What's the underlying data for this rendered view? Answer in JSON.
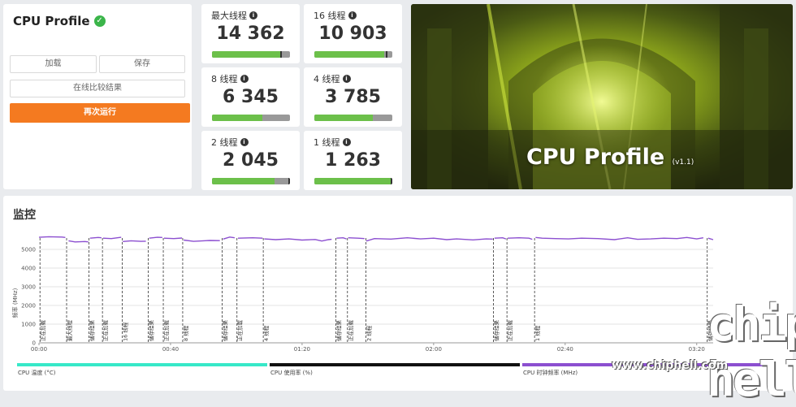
{
  "profile": {
    "title": "CPU Profile",
    "btn_load": "加载",
    "btn_save": "保存",
    "btn_compare": "在线比较结果",
    "btn_run": "再次运行"
  },
  "scores": [
    {
      "label": "最大线程",
      "value": "14 362",
      "fill": 0.9,
      "mark": 0.88
    },
    {
      "label": "16 线程",
      "value": "10 903",
      "fill": 0.9,
      "mark": 0.92
    },
    {
      "label": "8 线程",
      "value": "6 345",
      "fill": 0.65,
      "mark": null
    },
    {
      "label": "4 线程",
      "value": "3 785",
      "fill": 0.75,
      "mark": null
    },
    {
      "label": "2 线程",
      "value": "2 045",
      "fill": 0.8,
      "mark": 0.98
    },
    {
      "label": "1 线程",
      "value": "1 263",
      "fill": 0.98,
      "mark": 0.98
    }
  ],
  "banner": {
    "title": "CPU Profile",
    "version": "(v1.1)"
  },
  "monitor": {
    "title": "监控",
    "legend": [
      {
        "label": "CPU 温度 (°C)",
        "color": "#37e8c8"
      },
      {
        "label": "CPU 使用率 (%)",
        "color": "#111111"
      },
      {
        "label": "CPU 时钟频率 (MHz)",
        "color": "#8c4fd0"
      }
    ]
  },
  "chart_data": {
    "type": "line",
    "ylabel": "频率 (MHz)",
    "ylim": [
      0,
      6000
    ],
    "yticks": [
      0,
      1000,
      2000,
      3000,
      4000,
      5000
    ],
    "xticks": [
      "00:00",
      "00:40",
      "01:20",
      "02:00",
      "02:40",
      "03:20"
    ],
    "xlim": [
      0,
      205
    ],
    "series": [
      {
        "name": "CPU 时钟频率 (MHz)",
        "color": "#8c4fd0",
        "segments": [
          [
            [
              0,
              5650
            ],
            [
              3,
              5680
            ],
            [
              7,
              5660
            ],
            [
              8,
              5640
            ]
          ],
          [
            [
              9,
              5460
            ],
            [
              11,
              5400
            ],
            [
              14,
              5420
            ],
            [
              15,
              5400
            ]
          ],
          [
            [
              15.5,
              5600
            ],
            [
              18,
              5640
            ],
            [
              19,
              5620
            ]
          ],
          [
            [
              19.5,
              5600
            ],
            [
              22,
              5580
            ],
            [
              25,
              5650
            ]
          ],
          [
            [
              25.5,
              5420
            ],
            [
              28,
              5460
            ],
            [
              31,
              5430
            ],
            [
              32.5,
              5440
            ]
          ],
          [
            [
              33.5,
              5600
            ],
            [
              36,
              5650
            ],
            [
              37.5,
              5640
            ]
          ],
          [
            [
              38,
              5600
            ],
            [
              41,
              5580
            ],
            [
              43.5,
              5610
            ]
          ],
          [
            [
              44,
              5500
            ],
            [
              47,
              5430
            ],
            [
              50,
              5460
            ],
            [
              52,
              5480
            ],
            [
              55,
              5470
            ]
          ],
          [
            [
              56,
              5550
            ],
            [
              58,
              5660
            ],
            [
              59.5,
              5620
            ]
          ],
          [
            [
              60.5,
              5600
            ],
            [
              65,
              5620
            ],
            [
              68,
              5600
            ]
          ],
          [
            [
              68.5,
              5560
            ],
            [
              72,
              5520
            ],
            [
              76,
              5560
            ],
            [
              80,
              5500
            ],
            [
              84,
              5530
            ],
            [
              86,
              5450
            ],
            [
              88,
              5520
            ],
            [
              89,
              5540
            ]
          ],
          [
            [
              90.5,
              5600
            ],
            [
              92.5,
              5620
            ],
            [
              93.5,
              5560
            ]
          ],
          [
            [
              94,
              5620
            ],
            [
              97,
              5600
            ],
            [
              99,
              5580
            ]
          ],
          [
            [
              99.5,
              5450
            ],
            [
              102,
              5580
            ],
            [
              107,
              5550
            ],
            [
              112,
              5620
            ],
            [
              116,
              5560
            ],
            [
              120,
              5600
            ],
            [
              124,
              5520
            ],
            [
              127,
              5560
            ],
            [
              132,
              5510
            ],
            [
              136,
              5560
            ],
            [
              138,
              5550
            ]
          ],
          [
            [
              138.5,
              5600
            ],
            [
              141,
              5620
            ],
            [
              142,
              5560
            ]
          ],
          [
            [
              142.5,
              5600
            ],
            [
              146,
              5620
            ],
            [
              149,
              5600
            ],
            [
              150,
              5540
            ]
          ],
          [
            [
              151,
              5640
            ],
            [
              153,
              5600
            ],
            [
              157,
              5580
            ],
            [
              161,
              5560
            ],
            [
              165,
              5600
            ],
            [
              170,
              5580
            ],
            [
              175,
              5520
            ],
            [
              179,
              5620
            ],
            [
              182,
              5540
            ],
            [
              186,
              5560
            ],
            [
              190,
              5600
            ],
            [
              194,
              5580
            ],
            [
              197,
              5640
            ],
            [
              200,
              5560
            ],
            [
              202,
              5620
            ]
          ],
          [
            [
              203.5,
              5600
            ],
            [
              205,
              5520
            ]
          ]
        ]
      }
    ],
    "events": [
      {
        "t": 0.3,
        "label": "正在加载"
      },
      {
        "t": 8.4,
        "label": "最大线程"
      },
      {
        "t": 15.2,
        "label": "储存结果"
      },
      {
        "t": 19.3,
        "label": "正在加载"
      },
      {
        "t": 25.3,
        "label": "16 线程"
      },
      {
        "t": 33.2,
        "label": "储存结果"
      },
      {
        "t": 37.8,
        "label": "正在加载"
      },
      {
        "t": 43.7,
        "label": "8 线程"
      },
      {
        "t": 55.7,
        "label": "储存结果"
      },
      {
        "t": 60.2,
        "label": "正在加载"
      },
      {
        "t": 68.2,
        "label": "4 线程"
      },
      {
        "t": 90.3,
        "label": "储存结果"
      },
      {
        "t": 93.8,
        "label": "正在加载"
      },
      {
        "t": 99.4,
        "label": "2 线程"
      },
      {
        "t": 138.2,
        "label": "储存结果"
      },
      {
        "t": 142.3,
        "label": "正在加载"
      },
      {
        "t": 150.7,
        "label": "1 线程"
      },
      {
        "t": 203.2,
        "label": "储存结果"
      }
    ]
  },
  "watermark": {
    "logo": "chip hell",
    "url": "www.chiphell.com"
  }
}
